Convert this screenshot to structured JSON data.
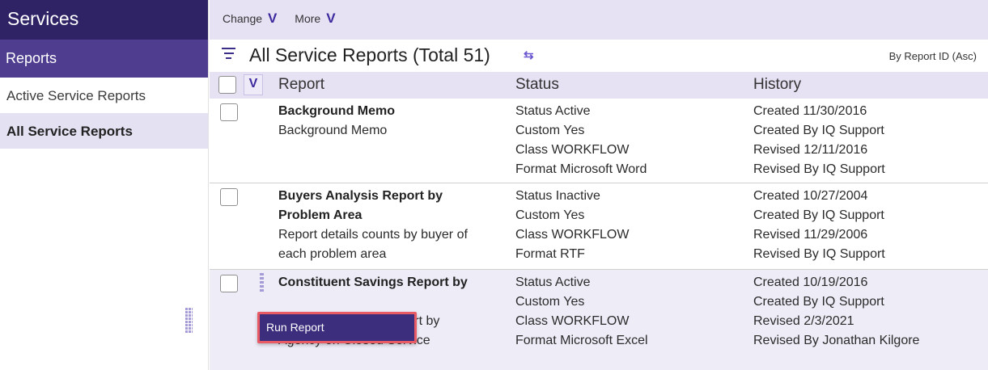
{
  "sidebar": {
    "title": "Services",
    "section": "Reports",
    "items": [
      {
        "label": "Active Service Reports",
        "active": false
      },
      {
        "label": "All Service Reports",
        "active": true
      }
    ]
  },
  "toolbar": {
    "change_label": "Change",
    "more_label": "More",
    "chevron": "V"
  },
  "list": {
    "title": "All Service Reports (Total 51)",
    "sort_label": "By Report ID (Asc)",
    "columns": {
      "report": "Report",
      "status": "Status",
      "history": "History"
    }
  },
  "rows": [
    {
      "name": "Background Memo",
      "desc": [
        "Background Memo"
      ],
      "status": [
        "Status Active",
        "Custom Yes",
        "Class WORKFLOW",
        "Format Microsoft Word"
      ],
      "history": [
        "Created 11/30/2016",
        "Created By IQ Support",
        "Revised 12/11/2016",
        "Revised By IQ Support"
      ]
    },
    {
      "name": [
        "Buyers Analysis Report by",
        "Problem Area"
      ],
      "desc": [
        "Report details counts by buyer of",
        "each problem area"
      ],
      "status": [
        "Status Inactive",
        "Custom Yes",
        "Class WORKFLOW",
        "Format RTF"
      ],
      "history": [
        "Created 10/27/2004",
        "Created By IQ Support",
        "Revised 11/29/2006",
        "Revised By IQ Support"
      ]
    },
    {
      "name": "Constituent Savings Report by",
      "desc": [
        "Report by",
        "Agency on Closed Service"
      ],
      "status": [
        "Status Active",
        "Custom Yes",
        "Class WORKFLOW",
        "Format Microsoft Excel"
      ],
      "history": [
        "Created 10/19/2016",
        "Created By IQ Support",
        "Revised 2/3/2021",
        "Revised By Jonathan Kilgore"
      ]
    }
  ],
  "context_menu": {
    "run_report": "Run Report"
  },
  "icons": {
    "filter": "filter-lines-icon",
    "refresh": "refresh-icon",
    "drag": "drag-handle-icon"
  },
  "colors": {
    "header_dark": "#2f2366",
    "header_mid": "#4f3e8f",
    "accent_light": "#e6e1f3",
    "menu_bg": "#3c2e7d",
    "menu_border": "#e85b64"
  }
}
